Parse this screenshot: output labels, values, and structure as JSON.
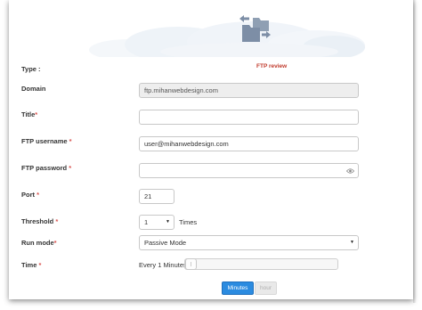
{
  "header": {
    "icon": "folder-transfer-icon"
  },
  "form": {
    "type": {
      "label": "Type :",
      "value": "FTP review"
    },
    "domain": {
      "label": "Domain",
      "value": "ftp.mihanwebdesign.com"
    },
    "title": {
      "label": "Title",
      "required_mark": "*",
      "value": ""
    },
    "ftp_username": {
      "label": "FTP username",
      "required_mark": "*",
      "value": "user@mihanwebdesign.com"
    },
    "ftp_password": {
      "label": "FTP password",
      "required_mark": "*",
      "value": "",
      "icon": "eye-icon"
    },
    "port": {
      "label": "Port",
      "required_mark": "*",
      "value": "21"
    },
    "threshold": {
      "label": "Threshold",
      "required_mark": "*",
      "value": "1",
      "suffix": "Times"
    },
    "run_mode": {
      "label": "Run mode",
      "required_mark": "*",
      "value": "Passive Mode"
    },
    "time": {
      "label": "Time",
      "required_mark": "*",
      "every_text": "Every 1 Minutes",
      "slider_value_fraction": 0.0,
      "unit_buttons": {
        "active": "Minutes",
        "inactive": "hour"
      }
    }
  },
  "colors": {
    "accent": "#2b8be0",
    "required": "#d9534f",
    "type_value": "#c0392b"
  }
}
